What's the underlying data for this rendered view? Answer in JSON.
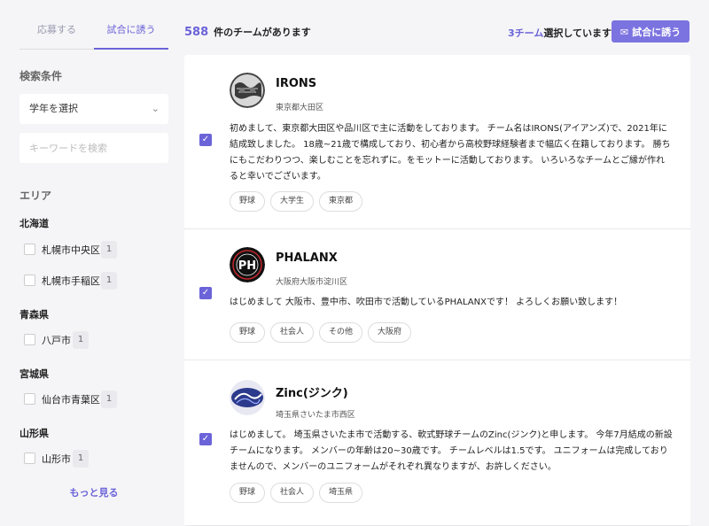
{
  "tabs": [
    {
      "label": "応募する"
    },
    {
      "label": "試合に誘う"
    }
  ],
  "filters": {
    "section_title": "検索条件",
    "grade_select": "学年を選択",
    "keyword_placeholder": "キーワードを検索",
    "area_title": "エリア",
    "more_label": "もっと見る"
  },
  "areas": [
    {
      "pref": "北海道",
      "cities": [
        {
          "name": "札幌市中央区",
          "count": "1"
        },
        {
          "name": "札幌市手稲区",
          "count": "1"
        }
      ]
    },
    {
      "pref": "青森県",
      "cities": [
        {
          "name": "八戸市",
          "count": "1"
        }
      ]
    },
    {
      "pref": "宮城県",
      "cities": [
        {
          "name": "仙台市青葉区",
          "count": "1"
        }
      ]
    },
    {
      "pref": "山形県",
      "cities": [
        {
          "name": "山形市",
          "count": "1"
        }
      ]
    }
  ],
  "header": {
    "team_count": "588",
    "team_count_label": "件のチームがあります",
    "selected_count": "3チーム",
    "selected_label": "選択しています",
    "invite_button": "試合に誘う"
  },
  "teams": [
    {
      "name": "IRONS",
      "location": "東京都大田区",
      "description": "初めまして、東京都大田区や品川区で主に活動をしております。 チーム名はIRONS(アイアンズ)で、2021年に結成致しました。 18歳~21歳で構成しており、初心者から高校野球経験者まで幅広く在籍しております。 勝ちにもこだわりつつ、楽しむことを忘れずに。をモットーに活動しております。 いろいろなチームとご縁が作れると幸いでございます。",
      "tags": [
        "野球",
        "大学生",
        "東京都"
      ],
      "checked": true,
      "logo_icon": "irons-logo-icon"
    },
    {
      "name": "PHALANX",
      "location": "大阪府大阪市淀川区",
      "description": "はじめまして 大阪市、豊中市、吹田市で活動しているPHALANXです！ よろしくお願い致します！",
      "tags": [
        "野球",
        "社会人",
        "その他",
        "大阪府"
      ],
      "checked": true,
      "logo_icon": "phalanx-logo-icon"
    },
    {
      "name": "Zinc(ジンク)",
      "location": "埼玉県さいたま市西区",
      "description": "はじめまして。 埼玉県さいたま市で活動する、軟式野球チームのZinc(ジンク)と申します。 今年7月結成の新設チームになります。 メンバーの年齢は20~30歳です。 チームレベルは1.5です。 ユニフォームは完成しておりませんので、メンバーのユニフォームがそれぞれ異なりますが、お許しください。",
      "tags": [
        "野球",
        "社会人",
        "埼玉県"
      ],
      "checked": true,
      "logo_icon": "zinc-logo-icon"
    }
  ]
}
